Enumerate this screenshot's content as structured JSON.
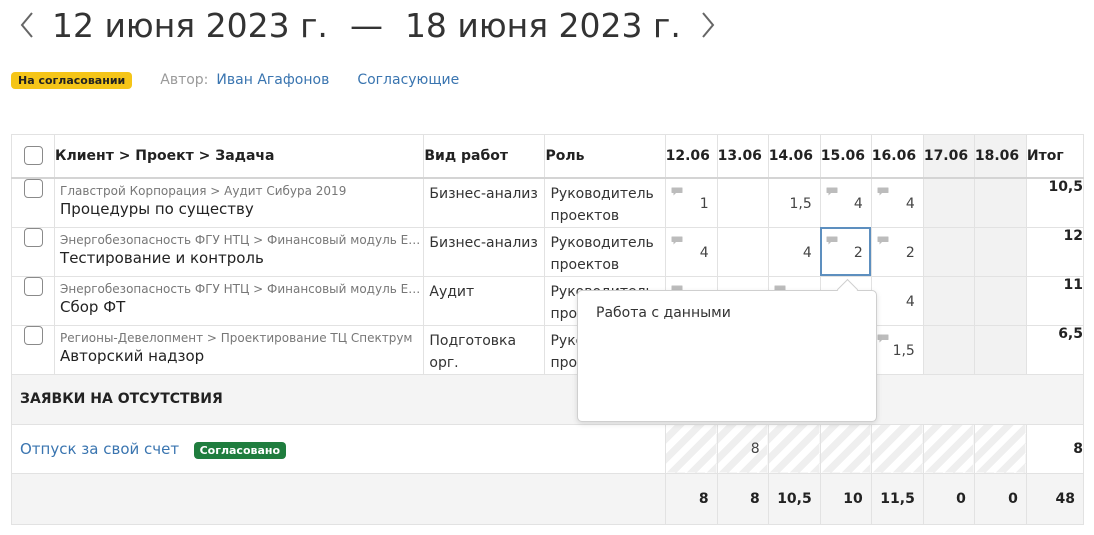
{
  "header": {
    "date_start": "12 июня 2023 г.",
    "date_separator": "—",
    "date_end": "18 июня 2023 г."
  },
  "meta": {
    "status_badge": "На согласовании",
    "author_label": "Автор:",
    "author_name": "Иван Агафонов",
    "approvers_link": "Согласующие"
  },
  "table": {
    "columns": {
      "task": "Клиент > Проект > Задача",
      "work_type": "Вид работ",
      "role": "Роль",
      "days": [
        "12.06",
        "13.06",
        "14.06",
        "15.06",
        "16.06",
        "17.06",
        "18.06"
      ],
      "total": "Итог"
    },
    "rows": [
      {
        "crumb": "Главстрой Корпорация > Аудит Сибура 2019",
        "task": "Процедуры по существу",
        "work_type": "Бизнес-анализ",
        "role": "Руководитель проектов",
        "hours": [
          "1",
          "",
          "1,5",
          "4",
          "4",
          "",
          ""
        ],
        "comments": [
          true,
          false,
          false,
          true,
          true,
          false,
          false
        ],
        "total": "10,5"
      },
      {
        "crumb": "Энергобезопасность ФГУ НТЦ > Финансовый модуль ERP -...",
        "task": "Тестирование и контроль",
        "work_type": "Бизнес-анализ",
        "role": "Руководитель проектов",
        "hours": [
          "4",
          "",
          "4",
          "2",
          "2",
          "",
          ""
        ],
        "comments": [
          true,
          false,
          false,
          true,
          true,
          false,
          false
        ],
        "total": "12"
      },
      {
        "crumb": "Энергобезопасность ФГУ НТЦ > Финансовый модуль ERP -...",
        "task": "Сбор ФТ",
        "work_type": "Аудит",
        "role": "Руководитель проектов",
        "hours": [
          "",
          "",
          "",
          "",
          "4",
          "",
          ""
        ],
        "comments": [
          true,
          false,
          true,
          false,
          false,
          false,
          false
        ],
        "total": "11"
      },
      {
        "crumb": "Регионы-Девелопмент > Проектирование ТЦ Спектрум",
        "task": "Авторский надзор",
        "work_type": "Подготовка орг.",
        "role": "Руководитель проектов",
        "hours": [
          "",
          "",
          "",
          "",
          "1,5",
          "",
          ""
        ],
        "comments": [
          false,
          false,
          false,
          false,
          true,
          false,
          false
        ],
        "total": "6,5"
      }
    ],
    "absence_section": "ЗАЯВКИ НА ОТСУТСТВИЯ",
    "absence": {
      "label": "Отпуск за свой счет",
      "badge": "Согласовано",
      "hours": [
        "",
        "8",
        "",
        "",
        "",
        "",
        ""
      ],
      "total": "8"
    },
    "sums": [
      "8",
      "8",
      "10,5",
      "10",
      "11,5",
      "0",
      "0"
    ],
    "sum_total": "48"
  },
  "tooltip": {
    "text": "Работа с данными"
  },
  "colors": {
    "link": "#3a75b0",
    "status_pending": "#f5c518",
    "status_approved": "#1f7d3e",
    "selected_cell": "#5d8fbf"
  }
}
